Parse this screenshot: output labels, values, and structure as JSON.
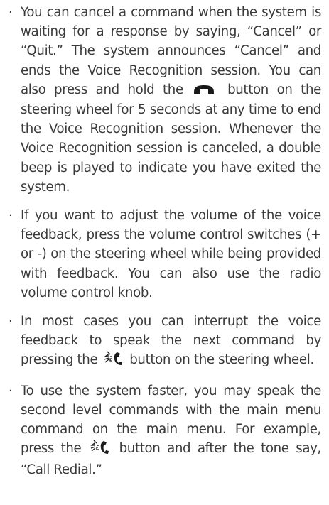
{
  "items": [
    {
      "bullet": "·",
      "text_a": "You can cancel a command when the system is waiting for a response by saying, “Cancel” or “Quit.” The system announces “Cancel” and ends the Voice Recognition session. You can also press and hold the",
      "icon": "phone-hang-up-icon",
      "text_b": "button on the steering wheel for 5 seconds at any time to end the Voice Recognition session. Whenever the Voice Recognition session is canceled, a double beep is played to indicate you have exited the system."
    },
    {
      "bullet": "·",
      "text_a": "If you want to adjust the volume of the voice feedback, press the volume control switches (+ or -) on the steering wheel while being provided with feedback. You can also use the radio volume control knob."
    },
    {
      "bullet": "·",
      "text_a": "In most cases you can interrupt the voice feedback to speak the next command by pressing the",
      "icon": "talk-phone-icon",
      "text_b": "button on the steering wheel."
    },
    {
      "bullet": "·",
      "text_a": "To use the system faster, you may speak the second level commands with the main menu command on the main menu. For example, press the",
      "icon": "talk-phone-icon",
      "text_b": "button and after the tone say, “Call Redial.”"
    }
  ],
  "colors": {
    "text": "#3a3a3a",
    "icon": "#1a1a1a"
  }
}
